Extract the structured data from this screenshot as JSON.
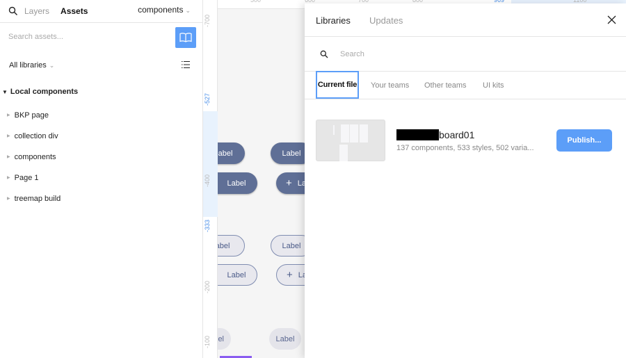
{
  "sidebar": {
    "tabs": [
      "Layers",
      "Assets"
    ],
    "page_selector": "components",
    "search_placeholder": "Search assets...",
    "library_filter": "All libraries",
    "section_title": "Local components",
    "items": [
      {
        "label": "BKP page"
      },
      {
        "label": "collection div"
      },
      {
        "label": "components"
      },
      {
        "label": "Page 1"
      },
      {
        "label": "treemap build"
      }
    ]
  },
  "canvas": {
    "hruler": [
      "500",
      "600",
      "700",
      "800",
      "969",
      "1100"
    ],
    "vruler": [
      "-700",
      "-527",
      "-400",
      "-333",
      "-200",
      "-100"
    ],
    "button_label": "Label",
    "partial_label": "abel",
    "partial_label_short": "el",
    "partial_label_plus": "La",
    "plus": "+"
  },
  "libraries": {
    "tabs": [
      "Libraries",
      "Updates"
    ],
    "search_placeholder": "Search",
    "subtabs": [
      "Current file",
      "Your teams",
      "Other teams",
      "UI kits"
    ],
    "file": {
      "name_visible": "board01",
      "meta": "137 components, 533 styles, 502 varia...",
      "publish_label": "Publish..."
    }
  },
  "colors": {
    "accent": "#5c9ef8",
    "button_dark": "#5f6f96"
  }
}
